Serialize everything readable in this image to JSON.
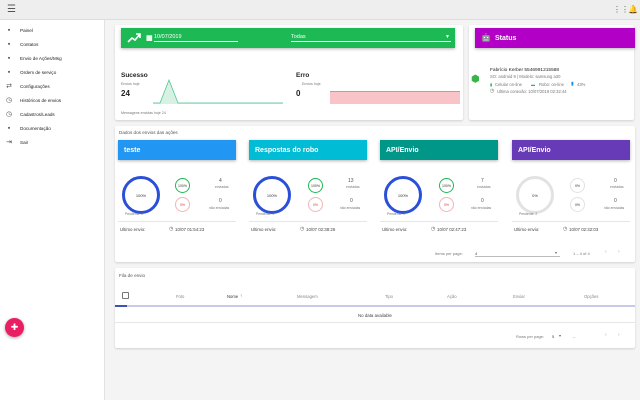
{
  "sidebar": {
    "items": [
      {
        "label": "Painel"
      },
      {
        "label": "Contatos"
      },
      {
        "label": "Envio de Ações/Msg"
      },
      {
        "label": "Ordem de serviço"
      },
      {
        "label": "Configurações"
      },
      {
        "label": "Históricos de envios"
      },
      {
        "label": "Cadastros/Leads"
      },
      {
        "label": "Documentação"
      },
      {
        "label": "Sair"
      }
    ]
  },
  "filter": {
    "date": "10/07/2019",
    "selection": "Todas"
  },
  "stats": {
    "success_label": "Sucesso",
    "success_sublabel": "Envios hoje",
    "success_value": "24",
    "error_label": "Erro",
    "error_sublabel": "Envios hoje",
    "error_value": "0",
    "footer": "Mensagens envidas hoje 24"
  },
  "status": {
    "title": "Status",
    "device_name": "Fabrício Kerber 5546991215588",
    "device_info": "SO: android 9 | Modelo: samsung a30",
    "celular_label": "Celular on-line",
    "robo_label": "Robo: on-line",
    "battery": "43%",
    "last_connection": "Ultima conexão: 10/07/2019 02:32:44"
  },
  "section_title": "Dados dos envios das ações",
  "actions": [
    {
      "name": "teste",
      "color": "#2196f3",
      "ring": "100%",
      "ok_pct": "100%",
      "err_pct": "0%",
      "sent": "4",
      "sent_label": "enviadas",
      "notsent": "0",
      "notsent_label": "não enviadas",
      "pending": "Pendente: 0",
      "last_label": "Ultimo envio:",
      "last_value": "10/07 01:54:23"
    },
    {
      "name": "Respostas do robo",
      "color": "#00bcd4",
      "ring": "100%",
      "ok_pct": "100%",
      "err_pct": "0%",
      "sent": "13",
      "sent_label": "enviadas",
      "notsent": "0",
      "notsent_label": "não enviadas",
      "pending": "Pendente: 0",
      "last_label": "Ultimo envio:",
      "last_value": "10/07 02:38:26"
    },
    {
      "name": "API/Envio",
      "color": "#009688",
      "ring": "100%",
      "ok_pct": "100%",
      "err_pct": "0%",
      "sent": "7",
      "sent_label": "enviadas",
      "notsent": "0",
      "notsent_label": "não enviadas",
      "pending": "Pendente: 0",
      "last_label": "Ultimo envio:",
      "last_value": "10/07 02:47:23"
    },
    {
      "name": "API/Envio",
      "color": "#673ab7",
      "ring": "0%",
      "ok_pct": "0%",
      "err_pct": "0%",
      "sent": "0",
      "sent_label": "enviadas",
      "notsent": "0",
      "notsent_label": "não enviadas",
      "pending": "Pendente: 2",
      "last_label": "Ultimo envio:",
      "last_value": "10/07 02:32:03"
    }
  ],
  "pager1": {
    "label": "Items per page:",
    "value": "4",
    "range": "1 – 4 of 4"
  },
  "queue": {
    "title": "Fila de envio",
    "columns": [
      "Foto",
      "Nome",
      "Mensagem",
      "Tipo",
      "Ação",
      "Enviar",
      "Opções"
    ],
    "empty": "No data available",
    "pager_label": "Rows per page:",
    "pager_value": "5",
    "pager_range": "–"
  },
  "colors": {
    "green": "#1db954",
    "purple": "#b200c6",
    "error_fill": "#f8c4c8",
    "success_line": "#3fc38a"
  },
  "icons": [
    "menu-icon",
    "apps-icon",
    "bell-icon",
    "trending-up-icon",
    "calendar-icon",
    "android-icon",
    "clock-icon"
  ]
}
